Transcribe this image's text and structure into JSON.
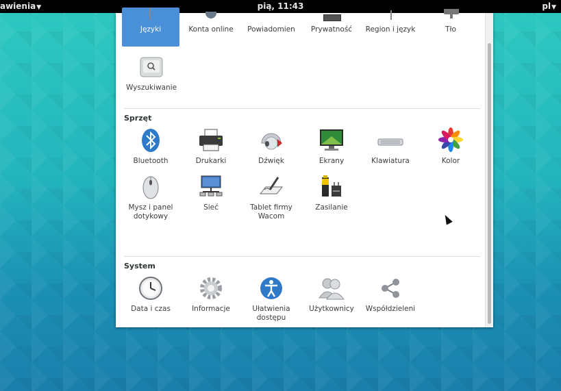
{
  "topbar": {
    "app_menu": "awienia",
    "clock": "pią, 11:43",
    "keyboard_layout": "pl"
  },
  "personal": {
    "items": [
      {
        "label": "Języki",
        "icon": "flag-icon",
        "selected": true
      },
      {
        "label": "Konta online",
        "icon": "online-accounts-icon"
      },
      {
        "label": "Powiadomien",
        "icon": "notifications-icon"
      },
      {
        "label": "Prywatność",
        "icon": "privacy-icon"
      },
      {
        "label": "Region i język",
        "icon": "region-icon"
      },
      {
        "label": "Tło",
        "icon": "background-icon"
      },
      {
        "label": "Wyszukiwanie",
        "icon": "search-icon"
      }
    ]
  },
  "hardware": {
    "title": "Sprzęt",
    "items": [
      {
        "label": "Bluetooth",
        "icon": "bluetooth-icon"
      },
      {
        "label": "Drukarki",
        "icon": "printer-icon"
      },
      {
        "label": "Dźwięk",
        "icon": "sound-icon"
      },
      {
        "label": "Ekrany",
        "icon": "display-icon"
      },
      {
        "label": "Klawiatura",
        "icon": "keyboard-icon"
      },
      {
        "label": "Kolor",
        "icon": "color-icon"
      },
      {
        "label": "Mysz i panel dotykowy",
        "icon": "mouse-icon"
      },
      {
        "label": "Sieć",
        "icon": "network-icon"
      },
      {
        "label": "Tablet firmy Wacom",
        "icon": "tablet-icon"
      },
      {
        "label": "Zasilanie",
        "icon": "power-icon"
      }
    ]
  },
  "system": {
    "title": "System",
    "items": [
      {
        "label": "Data i czas",
        "icon": "clock-icon"
      },
      {
        "label": "Informacje",
        "icon": "info-gear-icon"
      },
      {
        "label": "Ułatwienia dostępu",
        "icon": "accessibility-icon"
      },
      {
        "label": "Użytkownicy",
        "icon": "users-icon"
      },
      {
        "label": "Współdzieleni",
        "icon": "sharing-icon"
      }
    ]
  },
  "colors": {
    "selection": "#4a90d9",
    "topbar": "#000000"
  }
}
